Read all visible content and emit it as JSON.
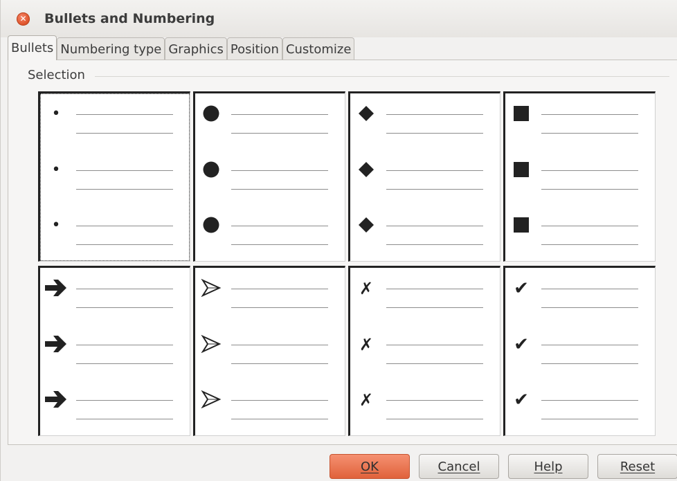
{
  "window": {
    "title": "Bullets and Numbering",
    "close_icon": "close-icon"
  },
  "tabs": [
    {
      "label": "Bullets",
      "active": true
    },
    {
      "label": "Numbering type",
      "active": false
    },
    {
      "label": "Graphics",
      "active": false
    },
    {
      "label": "Position",
      "active": false
    },
    {
      "label": "Customize",
      "active": false
    }
  ],
  "selection": {
    "label": "Selection",
    "selected_index": 0,
    "styles": [
      {
        "name": "small-dot",
        "glyph": "•"
      },
      {
        "name": "large-circle",
        "glyph": "●"
      },
      {
        "name": "diamond",
        "glyph": "◆"
      },
      {
        "name": "square",
        "glyph": "■"
      },
      {
        "name": "arrow",
        "glyph": "➔"
      },
      {
        "name": "arrowhead",
        "glyph": "➢"
      },
      {
        "name": "x-mark",
        "glyph": "✗"
      },
      {
        "name": "check-mark",
        "glyph": "✔"
      }
    ]
  },
  "buttons": {
    "ok": "OK",
    "cancel": "Cancel",
    "help": "Help",
    "reset": "Reset"
  }
}
